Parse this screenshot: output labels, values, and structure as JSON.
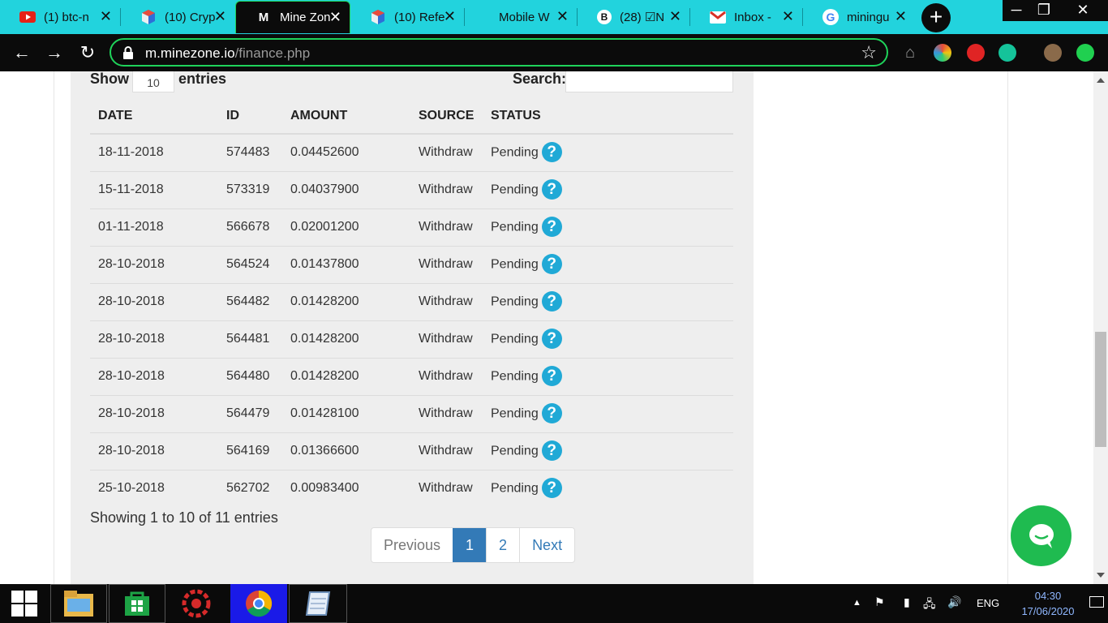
{
  "browser": {
    "tabs": [
      {
        "title": "(1) btc-n",
        "icon": "youtube-icon",
        "active": false
      },
      {
        "title": "(10) Cryp",
        "icon": "cube-icon",
        "active": false
      },
      {
        "title": "Mine Zon",
        "icon": "letter-m-icon",
        "active": true
      },
      {
        "title": "(10) Refe",
        "icon": "cube-icon",
        "active": false
      },
      {
        "title": "Mobile W",
        "icon": "",
        "active": false
      },
      {
        "title": "(28) ☑N",
        "icon": "letter-b-icon",
        "active": false
      },
      {
        "title": "Inbox - ",
        "icon": "gmail-icon",
        "active": false
      },
      {
        "title": "miningu",
        "icon": "google-icon",
        "active": false
      }
    ],
    "new_tab_label": "+",
    "url_host": "m.minezone.io",
    "url_path": "/finance.php"
  },
  "controls": {
    "show_label": "Show",
    "page_length": "10",
    "entries_label": "entries",
    "search_label": "Search:",
    "search_value": ""
  },
  "table": {
    "headers": [
      "DATE",
      "ID",
      "AMOUNT",
      "SOURCE",
      "STATUS"
    ],
    "rows": [
      [
        "18-11-2018",
        "574483",
        "0.04452600",
        "Withdraw",
        "Pending"
      ],
      [
        "15-11-2018",
        "573319",
        "0.04037900",
        "Withdraw",
        "Pending"
      ],
      [
        "01-11-2018",
        "566678",
        "0.02001200",
        "Withdraw",
        "Pending"
      ],
      [
        "28-10-2018",
        "564524",
        "0.01437800",
        "Withdraw",
        "Pending"
      ],
      [
        "28-10-2018",
        "564482",
        "0.01428200",
        "Withdraw",
        "Pending"
      ],
      [
        "28-10-2018",
        "564481",
        "0.01428200",
        "Withdraw",
        "Pending"
      ],
      [
        "28-10-2018",
        "564480",
        "0.01428200",
        "Withdraw",
        "Pending"
      ],
      [
        "28-10-2018",
        "564479",
        "0.01428100",
        "Withdraw",
        "Pending"
      ],
      [
        "28-10-2018",
        "564169",
        "0.01366600",
        "Withdraw",
        "Pending"
      ],
      [
        "25-10-2018",
        "562702",
        "0.00983400",
        "Withdraw",
        "Pending"
      ]
    ],
    "status_icon_glyph": "?"
  },
  "pagination": {
    "info": "Showing 1 to 10 of 11 entries",
    "previous": "Previous",
    "pages": [
      "1",
      "2"
    ],
    "current_page": "1",
    "next": "Next"
  },
  "taskbar": {
    "language": "ENG",
    "time": "04:30",
    "date": "17/06/2020"
  },
  "colors": {
    "tabstrip": "#22d3dd",
    "accent_green": "#1fd35a",
    "status_icon": "#20a9d6",
    "pager_active": "#337ab7",
    "chat_button": "#1fbb50"
  }
}
